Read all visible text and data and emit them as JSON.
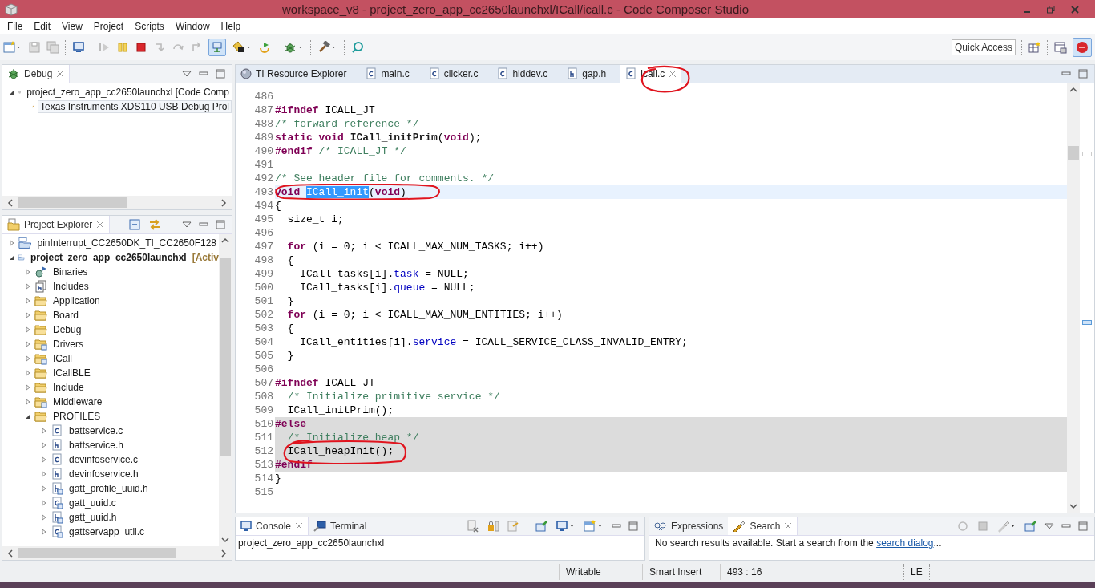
{
  "window": {
    "title": "workspace_v8 - project_zero_app_cc2650launchxl/ICall/icall.c - Code Composer Studio"
  },
  "menu": [
    "File",
    "Edit",
    "View",
    "Project",
    "Scripts",
    "Window",
    "Help"
  ],
  "quick_access": "Quick Access",
  "debug_view": {
    "title": "Debug",
    "items": [
      {
        "label": "project_zero_app_cc2650launchxl [Code Comp",
        "kind": "launch",
        "expanded": true,
        "selected": false,
        "children": [
          {
            "label": "Texas Instruments XDS110 USB Debug Prol",
            "kind": "target",
            "selected": true
          }
        ]
      }
    ]
  },
  "explorer": {
    "title": "Project Explorer",
    "items": [
      {
        "label": "pinInterrupt_CC2650DK_TI_CC2650F128",
        "kind": "project",
        "expanded": false
      },
      {
        "label": "project_zero_app_cc2650launchxl",
        "suffix": "[Activ",
        "kind": "project",
        "expanded": true,
        "children": [
          {
            "label": "Binaries",
            "kind": "binaries",
            "expanded": false
          },
          {
            "label": "Includes",
            "kind": "includes",
            "expanded": false
          },
          {
            "label": "Application",
            "kind": "folder",
            "expanded": false
          },
          {
            "label": "Board",
            "kind": "folder",
            "expanded": false
          },
          {
            "label": "Debug",
            "kind": "folder",
            "expanded": false
          },
          {
            "label": "Drivers",
            "kind": "linked-folder",
            "expanded": false
          },
          {
            "label": "ICall",
            "kind": "linked-folder",
            "expanded": false
          },
          {
            "label": "ICallBLE",
            "kind": "folder",
            "expanded": false
          },
          {
            "label": "Include",
            "kind": "folder",
            "expanded": false
          },
          {
            "label": "Middleware",
            "kind": "linked-folder",
            "expanded": false
          },
          {
            "label": "PROFILES",
            "kind": "folder",
            "expanded": true,
            "children": [
              {
                "label": "battservice.c",
                "kind": "c-file",
                "expanded": false
              },
              {
                "label": "battservice.h",
                "kind": "h-file",
                "expanded": false
              },
              {
                "label": "devinfoservice.c",
                "kind": "c-file",
                "expanded": false
              },
              {
                "label": "devinfoservice.h",
                "kind": "h-file",
                "expanded": false
              },
              {
                "label": "gatt_profile_uuid.h",
                "kind": "linked-h-file",
                "expanded": false
              },
              {
                "label": "gatt_uuid.c",
                "kind": "linked-c-file",
                "expanded": false
              },
              {
                "label": "gatt_uuid.h",
                "kind": "linked-h-file",
                "expanded": false
              },
              {
                "label": "gattservapp_util.c",
                "kind": "linked-c-file",
                "expanded": false
              }
            ]
          }
        ]
      }
    ]
  },
  "editor": {
    "tabs": [
      {
        "label": "TI Resource Explorer",
        "kind": "web",
        "selected": false
      },
      {
        "label": "main.c",
        "kind": "c-file",
        "selected": false
      },
      {
        "label": "clicker.c",
        "kind": "c-file",
        "selected": false
      },
      {
        "label": "hiddev.c",
        "kind": "c-file",
        "selected": false
      },
      {
        "label": "gap.h",
        "kind": "h-file",
        "selected": false
      },
      {
        "label": "icall.c",
        "kind": "c-file",
        "selected": true
      }
    ],
    "lines": [
      {
        "number": "486",
        "kind": "plain"
      },
      {
        "number": "487",
        "kind": "plain",
        "segments": [
          {
            "kind": "directive",
            "text": "#ifndef"
          },
          {
            "kind": "text",
            "text": " ICALL_JT"
          }
        ]
      },
      {
        "number": "488",
        "kind": "plain",
        "segments": [
          {
            "kind": "comment",
            "text": "/* forward reference */"
          }
        ]
      },
      {
        "number": "489",
        "kind": "plain",
        "segments": [
          {
            "kind": "keyword",
            "text": "static void"
          },
          {
            "kind": "function",
            "text": " ICall_initPrim"
          },
          {
            "kind": "text",
            "text": "("
          },
          {
            "kind": "keyword",
            "text": "void"
          },
          {
            "kind": "text",
            "text": ");"
          }
        ]
      },
      {
        "number": "490",
        "kind": "plain",
        "segments": [
          {
            "kind": "directive",
            "text": "#endif"
          },
          {
            "kind": "comment",
            "text": " /* ICALL_JT */"
          }
        ]
      },
      {
        "number": "491",
        "kind": "plain"
      },
      {
        "number": "492",
        "kind": "plain",
        "segments": [
          {
            "kind": "comment",
            "text": "/* See header file for comments. */"
          }
        ]
      },
      {
        "number": "493",
        "kind": "current",
        "segments": [
          {
            "kind": "keyword",
            "text": "void "
          },
          {
            "kind": "selection",
            "text": "ICall_init"
          },
          {
            "kind": "text",
            "text": "("
          },
          {
            "kind": "keyword",
            "text": "void"
          },
          {
            "kind": "text",
            "text": ")"
          }
        ]
      },
      {
        "number": "494",
        "kind": "plain",
        "segments": [
          {
            "kind": "text",
            "text": "{"
          }
        ]
      },
      {
        "number": "495",
        "kind": "plain",
        "segments": [
          {
            "kind": "text",
            "text": "  size_t i;"
          }
        ]
      },
      {
        "number": "496",
        "kind": "plain"
      },
      {
        "number": "497",
        "kind": "plain",
        "segments": [
          {
            "kind": "keyword",
            "text": "  for"
          },
          {
            "kind": "text",
            "text": " (i = 0; i < ICALL_MAX_NUM_TASKS; i++)"
          }
        ]
      },
      {
        "number": "498",
        "kind": "plain",
        "segments": [
          {
            "kind": "text",
            "text": "  {"
          }
        ]
      },
      {
        "number": "499",
        "kind": "plain",
        "segments": [
          {
            "kind": "text",
            "text": "    ICall_tasks[i]."
          },
          {
            "kind": "field",
            "text": "task"
          },
          {
            "kind": "text",
            "text": " = NULL;"
          }
        ]
      },
      {
        "number": "500",
        "kind": "plain",
        "segments": [
          {
            "kind": "text",
            "text": "    ICall_tasks[i]."
          },
          {
            "kind": "field",
            "text": "queue"
          },
          {
            "kind": "text",
            "text": " = NULL;"
          }
        ]
      },
      {
        "number": "501",
        "kind": "plain",
        "segments": [
          {
            "kind": "text",
            "text": "  }"
          }
        ]
      },
      {
        "number": "502",
        "kind": "plain",
        "segments": [
          {
            "kind": "keyword",
            "text": "  for"
          },
          {
            "kind": "text",
            "text": " (i = 0; i < ICALL_MAX_NUM_ENTITIES; i++)"
          }
        ]
      },
      {
        "number": "503",
        "kind": "plain",
        "segments": [
          {
            "kind": "text",
            "text": "  {"
          }
        ]
      },
      {
        "number": "504",
        "kind": "plain",
        "segments": [
          {
            "kind": "text",
            "text": "    ICall_entities[i]."
          },
          {
            "kind": "field",
            "text": "service"
          },
          {
            "kind": "text",
            "text": " = ICALL_SERVICE_CLASS_INVALID_ENTRY;"
          }
        ]
      },
      {
        "number": "505",
        "kind": "plain",
        "segments": [
          {
            "kind": "text",
            "text": "  }"
          }
        ]
      },
      {
        "number": "506",
        "kind": "plain"
      },
      {
        "number": "507",
        "kind": "plain",
        "segments": [
          {
            "kind": "directive",
            "text": "#ifndef"
          },
          {
            "kind": "text",
            "text": " ICALL_JT"
          }
        ]
      },
      {
        "number": "508",
        "kind": "plain",
        "segments": [
          {
            "kind": "comment",
            "text": "  /* Initialize primitive service */"
          }
        ]
      },
      {
        "number": "509",
        "kind": "plain",
        "segments": [
          {
            "kind": "text",
            "text": "  ICall_initPrim();"
          }
        ]
      },
      {
        "number": "510",
        "kind": "inactive",
        "segments": [
          {
            "kind": "directive",
            "text": "#else"
          }
        ]
      },
      {
        "number": "511",
        "kind": "inactive",
        "segments": [
          {
            "kind": "comment",
            "text": "  /* Initialize heap */"
          }
        ]
      },
      {
        "number": "512",
        "kind": "inactive",
        "segments": [
          {
            "kind": "text",
            "text": "  ICall_heapInit();"
          }
        ]
      },
      {
        "number": "513",
        "kind": "inactive",
        "segments": [
          {
            "kind": "directive",
            "text": "#endif"
          }
        ]
      },
      {
        "number": "514",
        "kind": "plain",
        "segments": [
          {
            "kind": "text",
            "text": "}"
          }
        ]
      },
      {
        "number": "515",
        "kind": "plain"
      }
    ]
  },
  "console": {
    "tabs": [
      {
        "label": "Console",
        "kind": "console",
        "selected": true
      },
      {
        "label": "Terminal",
        "kind": "terminal",
        "selected": false
      }
    ],
    "text": "project_zero_app_cc2650launchxl"
  },
  "search_view": {
    "tabs": [
      {
        "label": "Expressions",
        "kind": "expressions",
        "selected": false
      },
      {
        "label": "Search",
        "kind": "search",
        "selected": true
      }
    ],
    "message": "No search results available. Start a search from the ",
    "link": "search dialog",
    "message_end": "..."
  },
  "status_bar": {
    "mode": "Writable",
    "insert": "Smart Insert",
    "position": "493 : 16",
    "line_ending": "LE"
  }
}
